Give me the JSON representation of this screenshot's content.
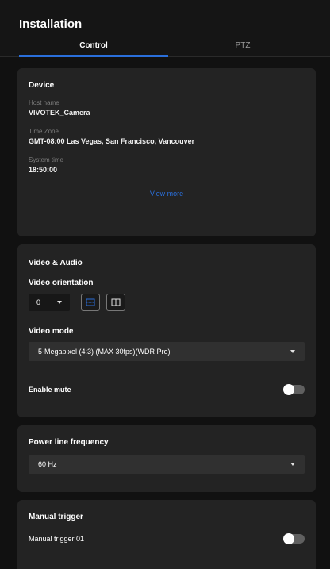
{
  "header": {
    "title": "Installation",
    "tabs": [
      {
        "label": "Control",
        "active": true
      },
      {
        "label": "PTZ",
        "active": false
      }
    ]
  },
  "device": {
    "title": "Device",
    "fields": [
      {
        "label": "Host name",
        "value": "VIVOTEK_Camera"
      },
      {
        "label": "Time Zone",
        "value": "GMT-08:00 Las Vegas, San Francisco, Vancouver"
      },
      {
        "label": "System time",
        "value": "18:50:00"
      }
    ],
    "view_more": "View more"
  },
  "video_audio": {
    "title": "Video & Audio",
    "orientation_label": "Video orientation",
    "orientation_value": "0",
    "mode_label": "Video mode",
    "mode_value": "5-Megapixel (4:3) (MAX 30fps)(WDR Pro)",
    "mute_label": "Enable mute",
    "mute_enabled": false
  },
  "power": {
    "title": "Power line frequency",
    "value": "60 Hz"
  },
  "manual": {
    "title": "Manual trigger",
    "item_label": "Manual trigger 01",
    "item_enabled": false
  },
  "colors": {
    "accent": "#2a6fdb",
    "card": "#232323",
    "background": "#111111"
  }
}
